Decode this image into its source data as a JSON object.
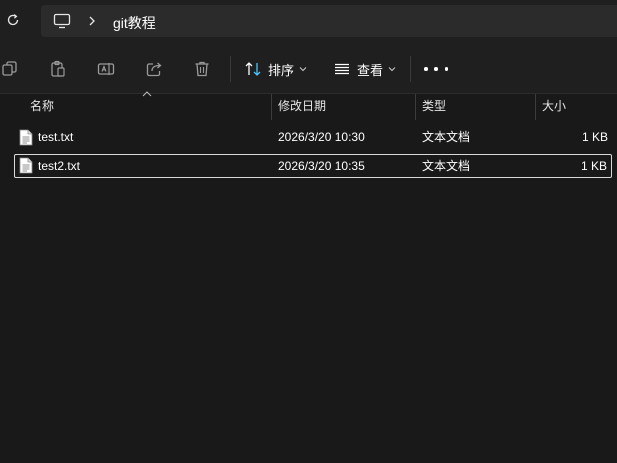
{
  "address": {
    "breadcrumb": "git教程"
  },
  "toolbar": {
    "sort_label": "排序",
    "view_label": "查看"
  },
  "columns": {
    "name": "名称",
    "date": "修改日期",
    "type": "类型",
    "size": "大小"
  },
  "files": [
    {
      "name": "test.txt",
      "date": "2026/3/20 10:30",
      "type": "文本文档",
      "size": "1 KB"
    },
    {
      "name": "test2.txt",
      "date": "2026/3/20 10:35",
      "type": "文本文档",
      "size": "1 KB"
    }
  ],
  "colors": {
    "background": "#191919",
    "chrome": "#1f1f1f",
    "address_box": "#2b2b2b",
    "accent_blue": "#4cc2ff",
    "selection_border": "#d9d9d9"
  }
}
